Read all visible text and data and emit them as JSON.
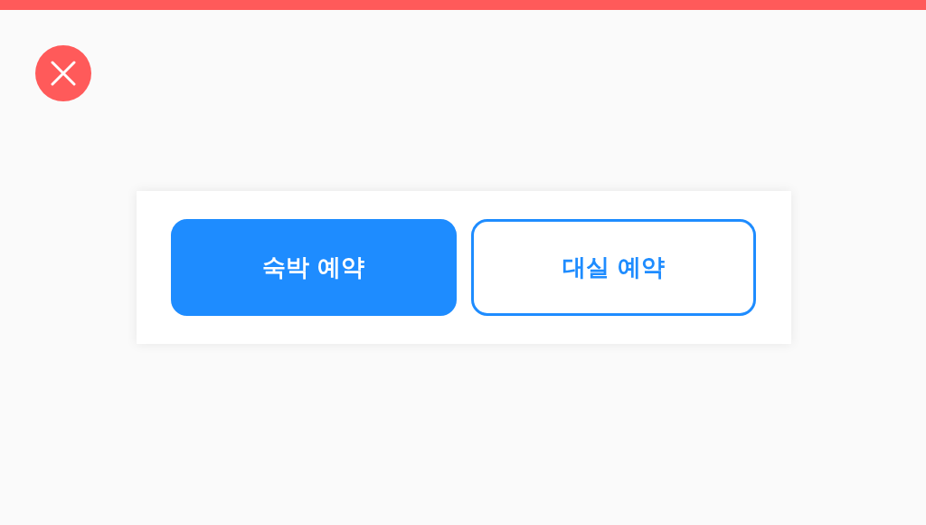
{
  "options": [
    {
      "label": "숙박 예약",
      "selected": true
    },
    {
      "label": "대실 예약",
      "selected": false
    }
  ]
}
